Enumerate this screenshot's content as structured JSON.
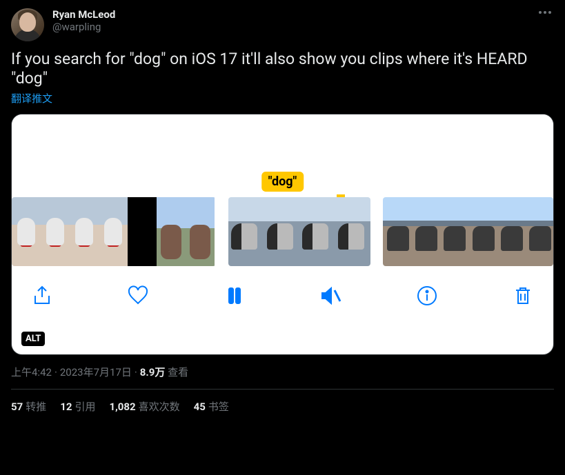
{
  "author": {
    "name": "Ryan McLeod",
    "handle": "@warpling"
  },
  "tweet_text": "If you search for \"dog\" on iOS 17 it'll also show you clips where it's HEARD \"dog\"",
  "translate_label": "翻译推文",
  "media": {
    "highlight_label": "\"dog\"",
    "alt_label": "ALT"
  },
  "meta": {
    "time": "上午4:42",
    "date": "2023年7月17日",
    "views_count": "8.9万",
    "views_label": "查看"
  },
  "stats": {
    "retweets": {
      "count": "57",
      "label": "转推"
    },
    "quotes": {
      "count": "12",
      "label": "引用"
    },
    "likes": {
      "count": "1,082",
      "label": "喜欢次数"
    },
    "bookmarks": {
      "count": "45",
      "label": "书签"
    }
  }
}
